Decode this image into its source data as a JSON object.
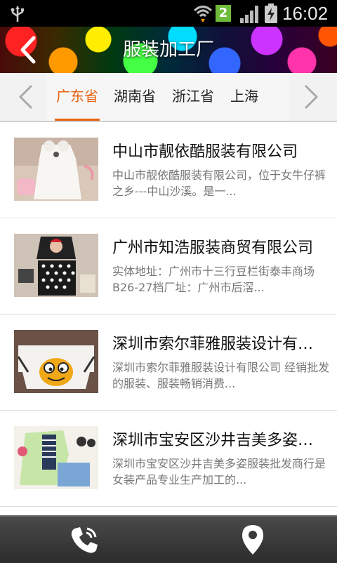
{
  "status": {
    "time": "16:02",
    "sim": "2"
  },
  "header": {
    "title": "服装加工厂"
  },
  "tabs": [
    {
      "label": "广东省",
      "active": true
    },
    {
      "label": "湖南省"
    },
    {
      "label": "浙江省"
    },
    {
      "label": "上海"
    }
  ],
  "companies": [
    {
      "name": "中山市靓依酷服装有限公司",
      "desc": "中山市靓依酷服装有限公司，位于女牛仔裤之乡---中山沙溪。是一..."
    },
    {
      "name": "广州市知浩服装商贸有限公司",
      "desc": "实体地址：广州市十三行豆栏街泰丰商场B26-27档厂址：广州市后滘..."
    },
    {
      "name": "深圳市索尔菲雅服装设计有限公司",
      "desc": "深圳市索尔菲雅服装设计有限公司 经销批发的服装、服装畅销消费..."
    },
    {
      "name": "深圳市宝安区沙井吉美多姿服装批发商行",
      "desc": "深圳市宝安区沙井吉美多姿服装批发商行是女装产品专业生产加工的..."
    }
  ],
  "colors": {
    "accent": "#e8620f",
    "bottom_bar": "#3a3a3a"
  },
  "icons": {
    "back": "chevron-left-icon",
    "prev": "chevron-left-icon",
    "next": "chevron-right-icon",
    "call": "phone-icon",
    "map": "location-pin-icon"
  }
}
